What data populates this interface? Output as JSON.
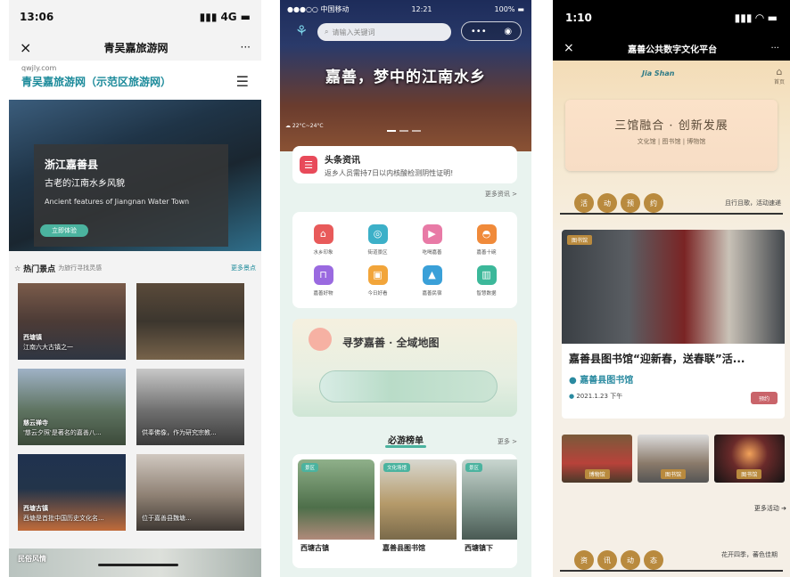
{
  "p1": {
    "status": {
      "time": "13:06",
      "signal": "4G"
    },
    "nav": {
      "close": "×",
      "title": "青吴嘉旅游网",
      "more": "···"
    },
    "site": {
      "domain": "qwjly.com",
      "name": "青吴嘉旅游网（示范区旅游网）"
    },
    "hero": {
      "line1": "浙江嘉善县",
      "line2": "古老的江南水乡风貌",
      "line3": "Ancient features of Jiangnan Water Town",
      "button": "立即体验"
    },
    "section": {
      "title": "热门景点",
      "subtitle": "为旅行寻找灵感",
      "more": "更多景点"
    },
    "tiles": [
      {
        "name": "西塘镇",
        "desc": "江南六大古镇之一"
      },
      {
        "name": "",
        "desc": ""
      },
      {
        "name": "慈云禅寺",
        "desc": "'慈云夕照'是著名的嘉善八..."
      },
      {
        "name": "",
        "desc": "供奉佛像，作为研究宗教..."
      },
      {
        "name": "西塘古镇",
        "desc": "西塘是首批中国历史文化名..."
      },
      {
        "name": "",
        "desc": "位于嘉善县魏塘..."
      }
    ],
    "bottom": {
      "label": "民俗风情"
    }
  },
  "p2": {
    "status": {
      "carrier": "●●●○○ 中国移动",
      "time": "12:21",
      "battery": "100%"
    },
    "search_placeholder": "请输入关键词",
    "slogan": "嘉善，梦中的江南水乡",
    "weather": "22°C~24°C",
    "news": {
      "title": "头条资讯",
      "text": "返乡人员需持7日以内核酸检测阴性证明!",
      "more": "更多资讯 >"
    },
    "icons": [
      {
        "label": "水乡印象",
        "color": "#e85a5a"
      },
      {
        "label": "街道景区",
        "color": "#3cb0c8"
      },
      {
        "label": "吃喝嘉善",
        "color": "#e87aa6"
      },
      {
        "label": "嘉善十碗",
        "color": "#f08a3a"
      },
      {
        "label": "嘉善好物",
        "color": "#9a6ae0"
      },
      {
        "label": "今日好看",
        "color": "#f2a53a"
      },
      {
        "label": "嘉善民宿",
        "color": "#3aa0d8"
      },
      {
        "label": "智慧数据",
        "color": "#3cb89a"
      }
    ],
    "map_title": "寻梦嘉善 · 全域地图",
    "rank": {
      "title": "必游榜单",
      "more": "更多 >"
    },
    "cards": [
      {
        "badge": "景区",
        "name": "西塘古镇"
      },
      {
        "badge": "文化场馆",
        "name": "嘉善县图书馆"
      },
      {
        "badge": "景区",
        "name": "西塘镇下"
      }
    ]
  },
  "p3": {
    "status": {
      "time": "1:10"
    },
    "nav": {
      "close": "×",
      "title": "嘉善公共数字文化平台",
      "more": "···"
    },
    "logo": "Jia Shan",
    "home": "首页",
    "banner": {
      "title": "三馆融合 · 创新发展",
      "subtitle": "文化馆 | 图书馆 | 博物馆"
    },
    "section1": {
      "chars": [
        "活",
        "动",
        "预",
        "约"
      ],
      "note": "且行且歌，活动速递"
    },
    "event": {
      "tag": "图书馆",
      "title": "嘉善县图书馆“迎新春，送春联”活...",
      "location": "嘉善县图书馆",
      "date": "2021.1.23 下午",
      "button": "预约"
    },
    "thumbs": [
      {
        "label": "博物馆"
      },
      {
        "label": "图书馆"
      },
      {
        "label": "图书馆"
      }
    ],
    "more": "更多活动",
    "section2": {
      "chars": [
        "资",
        "讯",
        "动",
        "态"
      ],
      "note": "花开四季，蕃色佳期"
    }
  }
}
